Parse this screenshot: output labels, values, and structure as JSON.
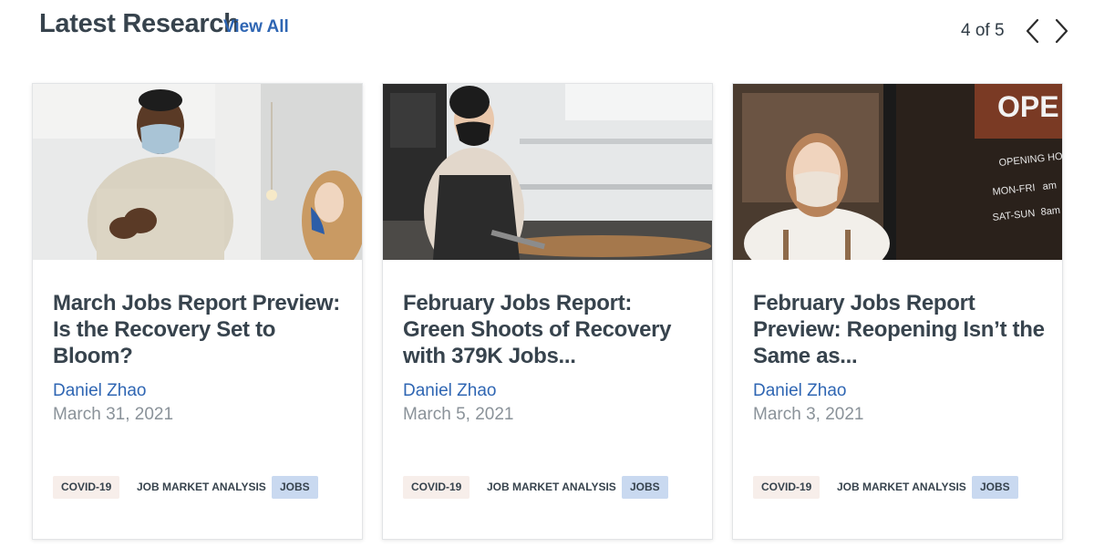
{
  "header": {
    "title": "Latest Research",
    "view_all": "View All",
    "pager": "4 of 5",
    "prev_icon": "chevron-left-icon",
    "next_icon": "chevron-right-icon"
  },
  "cards": [
    {
      "title": "March Jobs Report Preview: Is the Recovery Set to Bloom?",
      "author": "Daniel Zhao",
      "date": "March 31, 2021",
      "tags": [
        "COVID-19",
        "JOB MARKET ANALYSIS",
        "JOBS"
      ]
    },
    {
      "title": "February Jobs Report: Green Shoots of Recovery with 379K Jobs...",
      "author": "Daniel Zhao",
      "date": "March 5, 2021",
      "tags": [
        "COVID-19",
        "JOB MARKET ANALYSIS",
        "JOBS"
      ]
    },
    {
      "title": "February Jobs Report Preview: Reopening Isn’t the Same as...",
      "author": "Daniel Zhao",
      "date": "March 3, 2021",
      "tags": [
        "COVID-19",
        "JOB MARKET ANALYSIS",
        "JOBS"
      ]
    }
  ],
  "store_sign": {
    "open": "OPE",
    "hours_title": "OPENING HOU",
    "weekdays": "MON-FRI",
    "weekdays_time": "am",
    "weekend": "SAT-SUN",
    "weekend_time": "8am"
  },
  "colors": {
    "link": "#2f66b3",
    "heading": "#37434d",
    "muted": "#8a9299",
    "tag_covid_bg": "#f7eeea",
    "tag_jobs_bg": "#c9d9f0"
  }
}
